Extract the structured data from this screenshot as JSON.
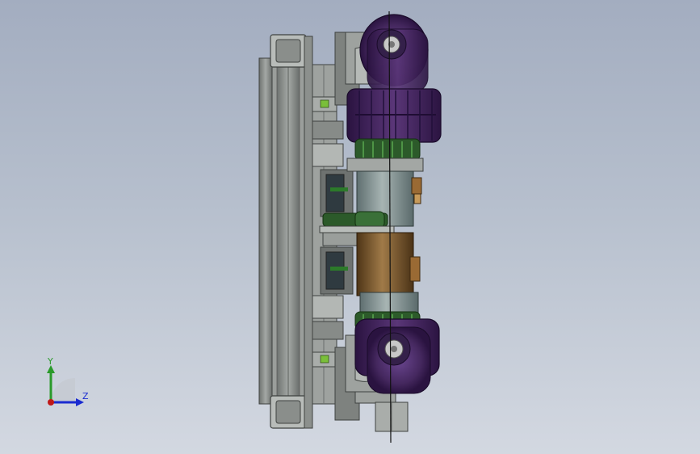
{
  "viewport": {
    "background_top": "#a3adc0",
    "background_bottom": "#d3d8e1"
  },
  "model": {
    "colors": {
      "frame": "#8f9390",
      "frame_dark": "#5c605e",
      "wheel_purple": "#3e2257",
      "wheel_purple_light": "#5a3678",
      "motor_grey": "#7f9090",
      "gearbox_bronze": "#7a5a32",
      "gear_green": "#2c5a2a",
      "bearing": "#c8c8c8",
      "shaft": "#111111"
    }
  },
  "triad": {
    "y_label": "Y",
    "z_label": "Z",
    "y_color": "#2a9a2a",
    "z_color": "#1a2bd0",
    "x_color": "#c01818",
    "icon": "coordinate-triad-icon"
  }
}
